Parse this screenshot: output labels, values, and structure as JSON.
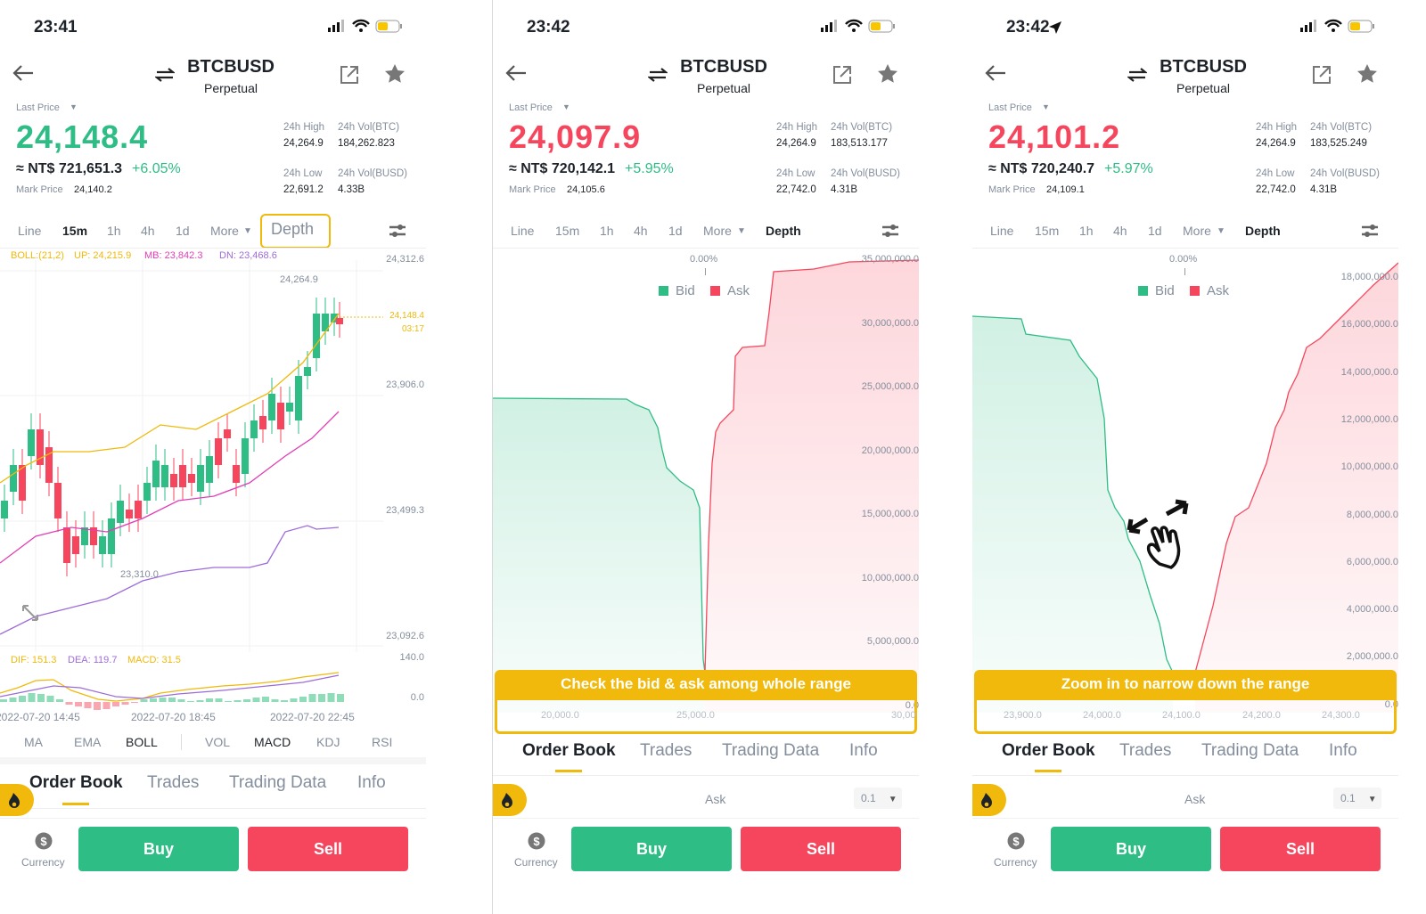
{
  "colors": {
    "bid": "#2ebd85",
    "ask": "#f6465d",
    "accent": "#f0b90b"
  },
  "panels": [
    {
      "time": "23:41",
      "symbol": "BTCBUSD",
      "contract": "Perpetual",
      "last_price_label": "Last Price",
      "price": "24,148.4",
      "price_color": "green",
      "fiat": "≈ NT$ 721,651.3",
      "change": "+6.05%",
      "mark_label": "Mark Price",
      "mark": "24,140.2",
      "high_label": "24h High",
      "high": "24,264.9",
      "volb_label": "24h Vol(BTC)",
      "volb": "184,262.823",
      "low_label": "24h Low",
      "low": "22,691.2",
      "volq_label": "24h Vol(BUSD)",
      "volq": "4.33B",
      "tabs": [
        "Line",
        "15m",
        "1h",
        "4h",
        "1d",
        "More",
        "Depth"
      ],
      "active_tab": "15m",
      "boll": "BOLL:(21,2)",
      "up": "UP: 24,215.9",
      "mb": "MB: 23,842.3",
      "dn": "DN: 23,468.6",
      "yticks": [
        "24,312.6",
        "23,906.0",
        "23,499.3",
        "23,092.6"
      ],
      "hi_mark": "24,264.9",
      "lo_mark": "23,310.0",
      "cur_price": "24,148.4",
      "countdown": "03:17",
      "dif": "DIF: 151.3",
      "dea": "DEA: 119.7",
      "macd": "MACD: 31.5",
      "macd_ticks": [
        "140.0",
        "0.0"
      ],
      "xticks": [
        "2022-07-20 14:45",
        "2022-07-20 18:45",
        "2022-07-20 22:45"
      ],
      "indicators": [
        "MA",
        "EMA",
        "BOLL",
        "VOL",
        "MACD",
        "KDJ",
        "RSI"
      ],
      "bottom_tabs": [
        "Order Book",
        "Trades",
        "Trading Data",
        "Info"
      ],
      "currency": "Currency",
      "buy": "Buy",
      "sell": "Sell"
    },
    {
      "time": "23:42",
      "symbol": "BTCBUSD",
      "contract": "Perpetual",
      "last_price_label": "Last Price",
      "price": "24,097.9",
      "price_color": "red",
      "fiat": "≈ NT$ 720,142.1",
      "change": "+5.95%",
      "mark_label": "Mark Price",
      "mark": "24,105.6",
      "high_label": "24h High",
      "high": "24,264.9",
      "volb_label": "24h Vol(BTC)",
      "volb": "183,513.177",
      "low_label": "24h Low",
      "low": "22,742.0",
      "volq_label": "24h Vol(BUSD)",
      "volq": "4.31B",
      "tabs": [
        "Line",
        "15m",
        "1h",
        "4h",
        "1d",
        "More",
        "Depth"
      ],
      "active_tab": "Depth",
      "pct": "0.00%",
      "bid": "Bid",
      "ask": "Ask",
      "yticks": [
        "35,000,000.0",
        "30,000,000.0",
        "25,000,000.0",
        "20,000,000.0",
        "15,000,000.0",
        "10,000,000.0",
        "5,000,000.0",
        "0.0"
      ],
      "xticks": [
        "20,000.0",
        "25,000.0",
        "30,00"
      ],
      "banner": "Check the bid & ask among whole range",
      "bottom_tabs": [
        "Order Book",
        "Trades",
        "Trading Data",
        "Info"
      ],
      "ask_col": "Ask",
      "step": "0.1",
      "currency": "Currency",
      "buy": "Buy",
      "sell": "Sell"
    },
    {
      "time": "23:42",
      "symbol": "BTCBUSD",
      "contract": "Perpetual",
      "last_price_label": "Last Price",
      "price": "24,101.2",
      "price_color": "red",
      "fiat": "≈ NT$ 720,240.7",
      "change": "+5.97%",
      "mark_label": "Mark Price",
      "mark": "24,109.1",
      "high_label": "24h High",
      "high": "24,264.9",
      "volb_label": "24h Vol(BTC)",
      "volb": "183,525.249",
      "low_label": "24h Low",
      "low": "22,742.0",
      "volq_label": "24h Vol(BUSD)",
      "volq": "4.31B",
      "tabs": [
        "Line",
        "15m",
        "1h",
        "4h",
        "1d",
        "More",
        "Depth"
      ],
      "active_tab": "Depth",
      "pct": "0.00%",
      "bid": "Bid",
      "ask": "Ask",
      "yticks": [
        "18,000,000.0",
        "16,000,000.0",
        "14,000,000.0",
        "12,000,000.0",
        "10,000,000.0",
        "8,000,000.0",
        "6,000,000.0",
        "4,000,000.0",
        "2,000,000.0",
        "0.0"
      ],
      "xticks": [
        "23,900.0",
        "24,000.0",
        "24,100.0",
        "24,200.0",
        "24,300.0"
      ],
      "banner": "Zoom in to narrow down the range",
      "bottom_tabs": [
        "Order Book",
        "Trades",
        "Trading Data",
        "Info"
      ],
      "ask_col": "Ask",
      "step": "0.1",
      "currency": "Currency",
      "buy": "Buy",
      "sell": "Sell"
    }
  ]
}
